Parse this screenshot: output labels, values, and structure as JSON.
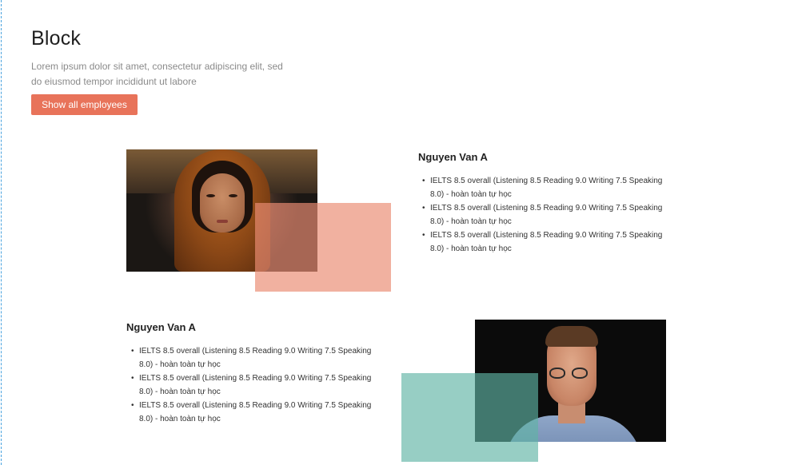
{
  "header": {
    "title": "Block",
    "subtitle": "Lorem ipsum dolor sit amet, consectetur adipiscing elit, sed do eiusmod tempor incididunt ut labore",
    "button_label": "Show all employees"
  },
  "employees": [
    {
      "name": "Nguyen Van A",
      "items": [
        "IELTS 8.5 overall (Listening 8.5 Reading 9.0 Writing 7.5 Speaking 8.0) - hoàn toàn tự học",
        "IELTS 8.5 overall (Listening 8.5 Reading 9.0 Writing 7.5 Speaking 8.0) - hoàn toàn tự học",
        "IELTS 8.5 overall (Listening 8.5 Reading 9.0 Writing 7.5 Speaking 8.0) - hoàn toàn tự học"
      ],
      "accent_color": "#eb8c73"
    },
    {
      "name": "Nguyen Van A",
      "items": [
        "IELTS 8.5 overall (Listening 8.5 Reading 9.0 Writing 7.5 Speaking 8.0) - hoàn toàn tự học",
        "IELTS 8.5 overall (Listening 8.5 Reading 9.0 Writing 7.5 Speaking 8.0) - hoàn toàn tự học",
        "IELTS 8.5 overall (Listening 8.5 Reading 9.0 Writing 7.5 Speaking 8.0) - hoàn toàn tự học"
      ],
      "accent_color": "#5fb4a5"
    }
  ],
  "colors": {
    "button": "#e8735a"
  }
}
